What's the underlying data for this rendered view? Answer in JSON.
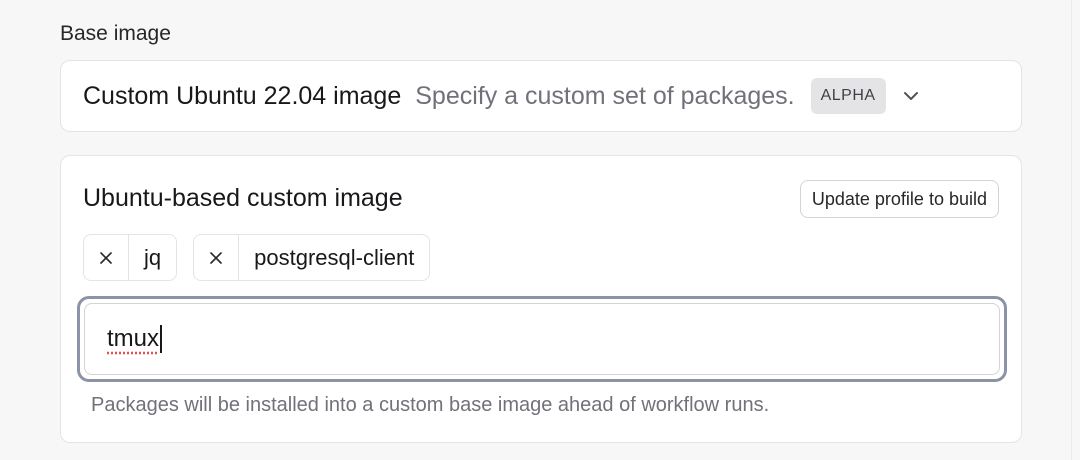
{
  "base_image": {
    "label": "Base image",
    "selected_title": "Custom Ubuntu 22.04 image",
    "selected_description": "Specify a custom set of packages.",
    "badge": "ALPHA",
    "chevron_icon": "chevron-down-icon"
  },
  "custom_image": {
    "title": "Ubuntu-based custom image",
    "build_button": "Update profile to build",
    "packages": [
      {
        "name": "jq",
        "remove_icon": "close-icon"
      },
      {
        "name": "postgresql-client",
        "remove_icon": "close-icon"
      }
    ],
    "input_value": "tmux",
    "help_text": "Packages will be installed into a custom base image ahead of workflow runs."
  },
  "colors": {
    "focus_ring": "#8a94a6",
    "badge_bg": "#e4e4e7",
    "muted_text": "#71717a",
    "spellcheck": "#e05252"
  }
}
